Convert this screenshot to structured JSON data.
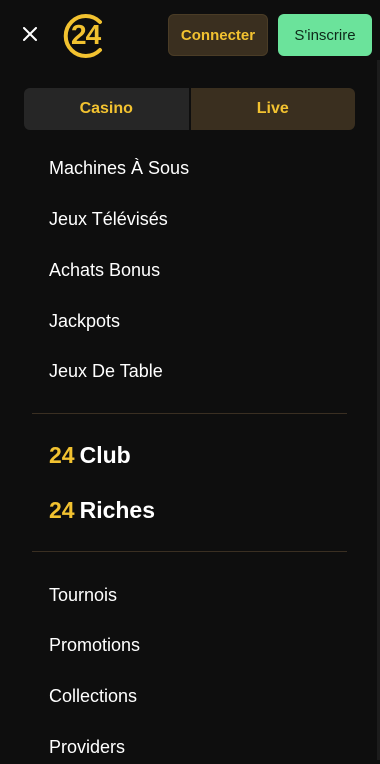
{
  "header": {
    "close_icon": "close-icon",
    "logo_text": "24",
    "connect_label": "Connecter",
    "signup_label": "S'inscrire"
  },
  "tabs": [
    {
      "label": "Casino"
    },
    {
      "label": "Live"
    }
  ],
  "menu_primary": [
    {
      "label": "Machines À Sous"
    },
    {
      "label": "Jeux Télévisés"
    },
    {
      "label": "Achats Bonus"
    },
    {
      "label": "Jackpots"
    },
    {
      "label": "Jeux De Table"
    }
  ],
  "clubs": [
    {
      "prefix": "24",
      "name": "Club"
    },
    {
      "prefix": "24",
      "name": "Riches"
    }
  ],
  "menu_secondary": [
    {
      "label": "Tournois"
    },
    {
      "label": "Promotions"
    },
    {
      "label": "Collections"
    },
    {
      "label": "Providers"
    }
  ],
  "colors": {
    "background": "#0e0e0e",
    "accent_gold": "#f2c230",
    "signup_green": "#6be39b",
    "connect_bg": "#3a2f1f"
  }
}
